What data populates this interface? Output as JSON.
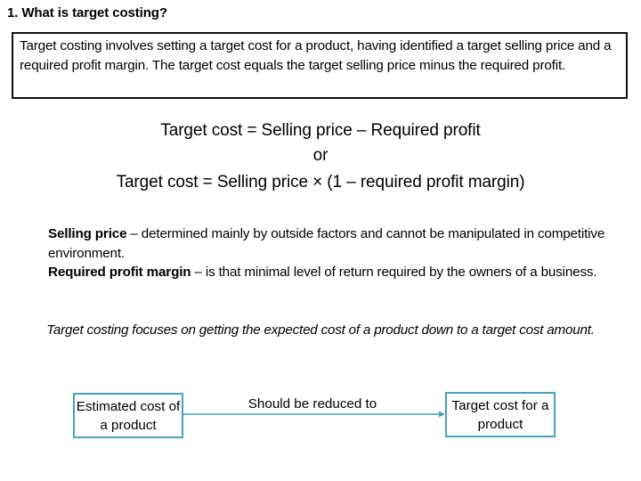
{
  "heading": "1. What is target costing?",
  "definition_box": {
    "text": "Target costing involves setting a target cost for a product, having identified a target selling price and a required profit margin. The target cost equals the target selling price minus the required profit."
  },
  "formulas": {
    "line1": "Target cost = Selling price – Required profit",
    "connector": "or",
    "line2": "Target cost = Selling price × (1 – required profit margin)"
  },
  "definitions": [
    {
      "term": "Selling price",
      "description": " – determined mainly by outside factors and cannot be manipulated in competitive environment."
    },
    {
      "term": "Required profit margin",
      "description": " – is that minimal level of return required by the owners of a business."
    }
  ],
  "note": "Target costing focuses on getting the expected cost of a product down to a target cost amount.",
  "flow": {
    "source_box": "Estimated cost of a product",
    "arrow_label": "Should be reduced to",
    "target_box": "Target cost for a product",
    "accent_color": "#4A9FBA"
  }
}
